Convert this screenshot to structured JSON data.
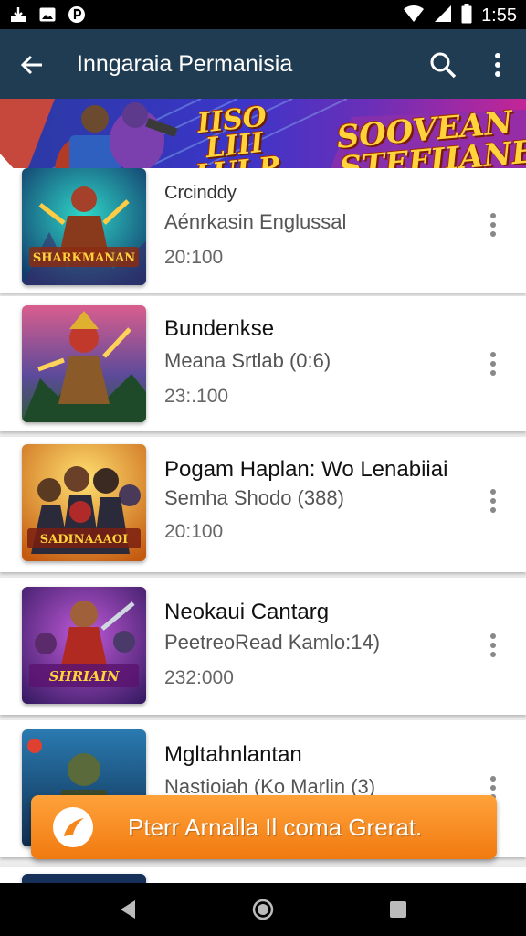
{
  "status_bar": {
    "time": "1:55",
    "left_icons": [
      "download-icon",
      "photo-icon",
      "p-app-icon"
    ],
    "right_icons": [
      "wifi-icon",
      "signal-icon",
      "battery-icon"
    ]
  },
  "app_bar": {
    "title": "Inngaraia Permanisia",
    "back_icon": "arrow-back-icon",
    "search_icon": "search-icon",
    "more_icon": "more-vert-icon",
    "background": "#1f3c52"
  },
  "banner": {
    "text_left": "IISO\nLIII\nLUI P",
    "text_right": "SOOVEAN\nSTEFIIANEI!"
  },
  "games": [
    {
      "title": "Crcinddy",
      "subtitle": "Aénrkasin Englussal",
      "count": "20:100",
      "thumb_text": "SHARKMANAN"
    },
    {
      "title": "Bundenkse",
      "subtitle": "Meana Srtlab (0:6)",
      "count": "23:.100",
      "thumb_text": ""
    },
    {
      "title": "Pogam Haplan: Wo Lenabiiai",
      "subtitle": "Semha Shodo (388)",
      "count": "20:100",
      "thumb_text": "SADINAAAOI"
    },
    {
      "title": "Neokaui Cantarg",
      "subtitle": "PeetreoRead Kamlo:14)",
      "count": "232:000",
      "thumb_text": "SHRIAIN"
    },
    {
      "title": "Mgltahnlantan",
      "subtitle": "Nastioiah (Ko Marlin (3)",
      "count": "",
      "thumb_text": ""
    }
  ],
  "cta": {
    "label": "Pterr Arnalla Il coma Grerat.",
    "color": "#f5861c"
  },
  "nav_bar": {
    "back": "nav-back-icon",
    "home": "nav-home-icon",
    "recents": "nav-recents-icon"
  }
}
